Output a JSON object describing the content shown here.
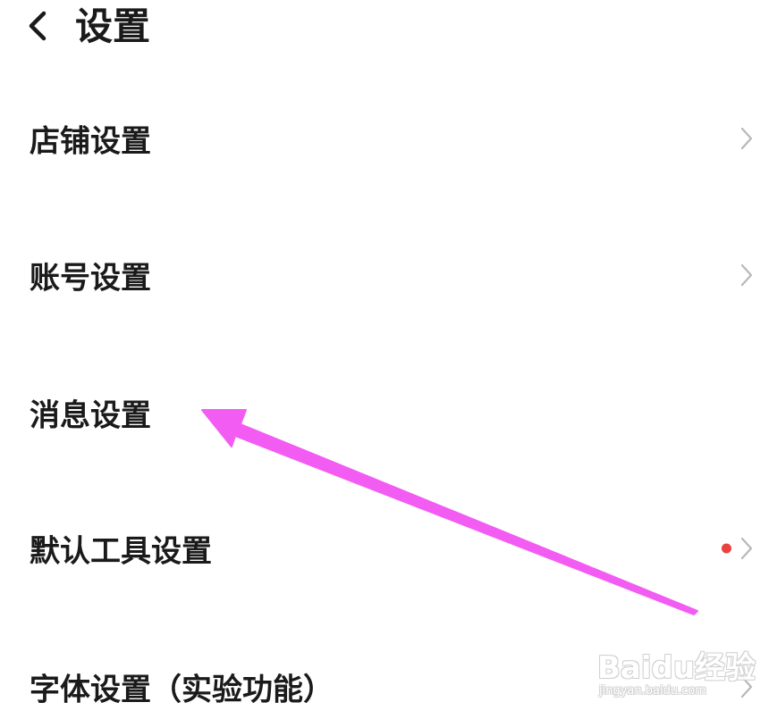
{
  "header": {
    "back_icon": "chevron-left-icon",
    "title": "设置"
  },
  "settings_items": [
    {
      "label": "店铺设置",
      "has_badge": false
    },
    {
      "label": "账号设置",
      "has_badge": false
    },
    {
      "label": "消息设置",
      "has_badge": false
    },
    {
      "label": "默认工具设置",
      "has_badge": true
    },
    {
      "label": "字体设置（实验功能）",
      "has_badge": false
    }
  ],
  "colors": {
    "text": "#1a1a1a",
    "chevron": "#b8b8b8",
    "badge": "#e8433e",
    "annotation_arrow": "#f25cf2"
  },
  "watermark": {
    "logo": "Baidu经验",
    "url": "jingyan.baidu.com"
  }
}
